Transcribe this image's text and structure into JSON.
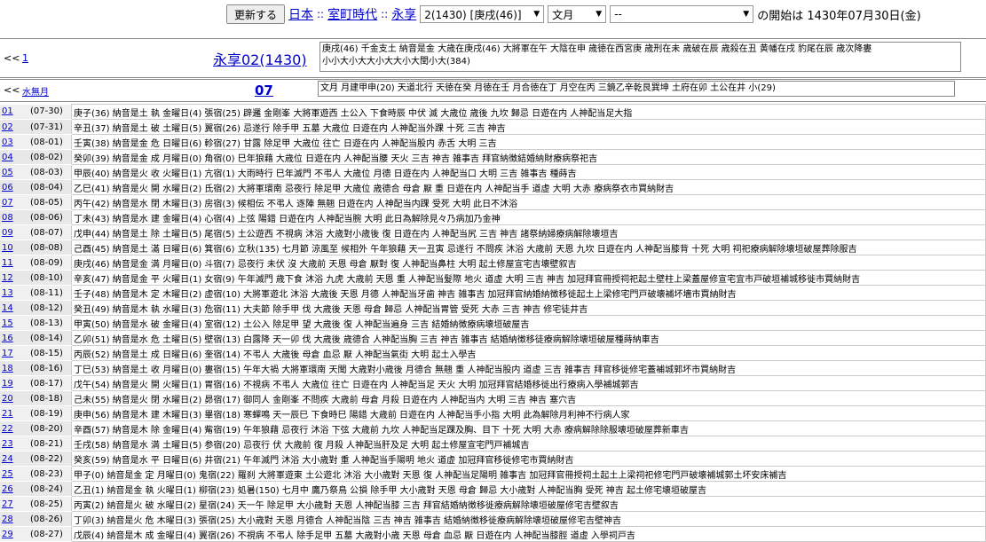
{
  "topbar": {
    "update_button": "更新する",
    "crumb_japan": "日本",
    "crumb_sep": "::",
    "crumb_period": "室町時代",
    "crumb_era": "永享",
    "year_select": "2(1430) [庚戌(46)]",
    "month_select": "文月",
    "day_select": "--",
    "tail_text": "の開始は 1430年07月30日(金)"
  },
  "nav1": {
    "prev_label": "<<",
    "prev_link": "1",
    "title": "永享02(1430)",
    "year_info_line1": "庚戌(46) 千金支土 納音是金 大歳在庚戌(46) 大將軍在午 大陰在申 歳徳在西宮庚 歳刑在未 歳破在辰 歳殺在丑 黄幡在戌 豹尾在辰 歳次降婁",
    "year_info_line2": "小小大小大大小大大小大閏小大(384)"
  },
  "nav2": {
    "prev_label": "<<",
    "prev_link": "水無月",
    "title": "07",
    "month_info": "文月 月建甲申(20) 天道北行 天徳在癸 月徳在壬 月合徳在丁 月空在丙 三鏡乙辛乾艮巽坤 土府在卯 土公在井 小(29)"
  },
  "days": [
    {
      "n": "01",
      "d": "(07-30)",
      "text": "庚子(36) 納音是土 執 金曜日(4) 張宿(25) 辟邏 金剛峯 大將軍遊西 土公入 下食時辰 中伏 滅 大歳位 歳後 九坎 歸忌 日遊在内 人神配当足大指"
    },
    {
      "n": "02",
      "d": "(07-31)",
      "text": "辛丑(37) 納音是土 破 土曜日(5) 翼宿(26) 忌遂行 除手甲 五墓 大歳位 日遊在内 人神配当外踝 十死 三吉 神吉"
    },
    {
      "n": "03",
      "d": "(08-01)",
      "text": "壬寅(38) 納音是金 危 日曜日(6) 軫宿(27) 甘露 除足甲 大歳位 往亡 日遊在内 人神配当股内 赤舌 大明 三吉"
    },
    {
      "n": "04",
      "d": "(08-02)",
      "text": "癸卯(39) 納音是金 成 月曜日(0) 角宿(0) 巳年狼藉 大歳位 日遊在内 人神配当腰 天火 三吉 神吉 雑事吉 拜官納徴結婚納財療病祭祀吉"
    },
    {
      "n": "05",
      "d": "(08-03)",
      "text": "甲辰(40) 納音是火 收 火曜日(1) 亢宿(1) 大雨時行 巳年滅門 不弔人 大歳位 月德 日遊在内 人神配当口 大明 三吉 雑事吉 種蒔吉"
    },
    {
      "n": "06",
      "d": "(08-04)",
      "text": "乙巳(41) 納音是火 開 水曜日(2) 氐宿(2) 大將軍環南 忌夜行 除足甲 大歳位 歳德合 母倉 厭 重 日遊在内 人神配当手 道虚 大明 大赤 療病祭衣市買納財吉"
    },
    {
      "n": "07",
      "d": "(08-05)",
      "text": "丙午(42) 納音是水 閉 木曜日(3) 房宿(3) 候相伝 不弔人 逐陣 無翹 日遊在内 人神配当内踝 受死 大明 此日不沐浴"
    },
    {
      "n": "08",
      "d": "(08-06)",
      "text": "丁未(43) 納音是水 建 金曜日(4) 心宿(4) 上弦 陽錯 日遊在内 人神配当腕 大明 此日為解除見々乃病加乃金神"
    },
    {
      "n": "09",
      "d": "(08-07)",
      "text": "戊申(44) 納音是土 除 土曜日(5) 尾宿(5) 土公遊西 不視病 沐浴 大歳對小歳後 復 日遊在内 人神配当尻 三吉 神吉 諸祭納婦療病解除壊垣吉"
    },
    {
      "n": "10",
      "d": "(08-08)",
      "text": "己酉(45) 納音是土 滿 日曜日(6) 箕宿(6) 立秋(135) 七月節 涼風至 候相外 午年狼藉 天一丑寅 忌遂行 不問疾 沐浴 大歳前 天恩 九坎 日遊在内 人神配当膝背 十死 大明 祠祀療病解除壊垣破屋葬除服吉"
    },
    {
      "n": "11",
      "d": "(08-09)",
      "text": "庚戌(46) 納音是金 満 月曜日(0) 斗宿(7) 忌夜行 未伏 沒 大歳前 天恩 母倉 厭對 復 人神配当鼻柱 大明 起土修屋宣宅吉壊壁叙吉"
    },
    {
      "n": "12",
      "d": "(08-10)",
      "text": "辛亥(47) 納音是金 平 火曜日(1) 女宿(9) 午年滅門 歳下食 沐浴 九虎 大歳前 天恩 重 人神配当髮際 地火 道虚 大明 三吉 神吉 加冠拜官冊授祠祀起土壁柱上梁蓋屋修宣宅宜市戸破垣補城移徙市買納財吉"
    },
    {
      "n": "13",
      "d": "(08-11)",
      "text": "壬子(48) 納音是木 定 木曜日(2) 虚宿(10) 大將軍遊北 沐浴 大歳後 天恩 月德 人神配当牙歯 神吉 雑事吉 加冠拜官納婚納徴移徙起土上梁修宅門戸破壊補坏墻市買納財吉"
    },
    {
      "n": "14",
      "d": "(08-12)",
      "text": "癸丑(49) 納音是木 執 水曜日(3) 危宿(11) 大夫節 除手甲 伐 大歳後 天恩 母倉 歸忌 人神配当胃管 受死 大赤 三吉 神吉 修宅徒井吉"
    },
    {
      "n": "15",
      "d": "(08-13)",
      "text": "甲寅(50) 納音是水 破 金曜日(4) 室宿(12) 土公入 除足甲 望 大歳後 復 人神配当遍身 三吉 結婚納徴療病壊垣破屋吉"
    },
    {
      "n": "16",
      "d": "(08-14)",
      "text": "乙卯(51) 納音是水 危 土曜日(5) 壁宿(13) 白露降 天一卯 伐 大歳後 歳德合 人神配当胸 三吉 神吉 雑事吉 結婚納徴移徒療病解除壊垣破屋種蒔納車吉"
    },
    {
      "n": "17",
      "d": "(08-15)",
      "text": "丙辰(52) 納音是土 成 日曜日(6) 奎宿(14) 不弔人 大歳後 母倉 血忌 厭 人神配当氣街 大明 起土入學吉"
    },
    {
      "n": "18",
      "d": "(08-16)",
      "text": "丁巳(53) 納音是土 收 月曜日(0) 婁宿(15) 午年大禍 大將軍環南 天聞 大歳對小歳後 月德合 無翹 重 人神配当股内 道虚 三吉 雑事吉 拜官移徙修宅蓋補城郭坏市買納財吉"
    },
    {
      "n": "19",
      "d": "(08-17)",
      "text": "戊午(54) 納音是火 開 火曜日(1) 胃宿(16) 不視病 不弔人 大歳位 往亡 日遊在内 人神配当足 天火 大明 加冠拜官結婚移徙出行療病入學補城郭吉"
    },
    {
      "n": "20",
      "d": "(08-18)",
      "text": "己未(55) 納音是火 閉 水曜日(2) 昴宿(17) 御同人 金剛峯 不問疾 大歳前 母倉 月殺 日遊在内 人神配当内 大明 三吉 神吉 塞穴吉"
    },
    {
      "n": "21",
      "d": "(08-19)",
      "text": "庚申(56) 納音是木 建 木曜日(3) 畢宿(18) 寒蟬鳴 天一辰巳 下食時巳 陽錯 大歳前 日遊在内 人神配当手小指 大明 此為解除月利神不行病人家"
    },
    {
      "n": "22",
      "d": "(08-20)",
      "text": "辛酉(57) 納音是木 除 金曜日(4) 觜宿(19) 午年狼藉 忌夜行 沐浴 下弦 大歳前 九坎 人神配当足踝及胸、目下 十死 大明 大赤 療病解除除服壊垣破屋葬新車吉"
    },
    {
      "n": "23",
      "d": "(08-21)",
      "text": "壬戌(58) 納音是水 満 土曜日(5) 参宿(20) 忌夜行 伏 大歳前 復 月殺 人神配当肝及足 大明 起土修屋宣宅門戸補城吉"
    },
    {
      "n": "24",
      "d": "(08-22)",
      "text": "癸亥(59) 納音是水 平 日曜日(6) 井宿(21) 午年滅門 沐浴 大小歳對 重 人神配当手陽明 地火 道虚 加冠拜官移徙修宅市買納財吉"
    },
    {
      "n": "25",
      "d": "(08-23)",
      "text": "甲子(0) 納音是金 定 月曜日(0) 鬼宿(22) 羅刹 大將軍遊東 土公遊北 沐浴 大小歳對 天恩 復 人神配当足陽明 雑事吉 加冠拜官冊授祠土起土上梁祠祀修宅門戸破壊補城郭土坏安床補吉"
    },
    {
      "n": "26",
      "d": "(08-24)",
      "text": "乙丑(1) 納音是金 執 火曜日(1) 柳宿(23) 処暑(150) 七月中 鷹乃祭鳥 公損 除手甲 大小歳對 天恩 母倉 歸忌 大小歳對 人神配当胸 受死 神吉 起土修宅壊垣破屋吉"
    },
    {
      "n": "27",
      "d": "(08-25)",
      "text": "丙寅(2) 納音是火 破 水曜日(2) 星宿(24) 天一午 除足甲 大小歳對 天恩 人神配当膝 三吉 拜官結婚納徴移徙療病解除壊垣破屋修宅吉壁叙吉"
    },
    {
      "n": "28",
      "d": "(08-26)",
      "text": "丁卯(3) 納音是火 危 木曜日(3) 張宿(25) 大小歳對 天恩 月德合 人神配当陰 三吉 神吉 雑事吉 結婚納徴移徙療病解除壊垣破屋修宅吉壁神吉"
    },
    {
      "n": "29",
      "d": "(08-27)",
      "text": "戊辰(4) 納音是木 成 金曜日(4) 翼宿(26) 不視病 不弔人 除手足甲 五墓 大歳對小歳 天恩 母倉 血忌 厭 日遊在内 人神配当膝脛 道虚 入學祠戸吉"
    }
  ]
}
